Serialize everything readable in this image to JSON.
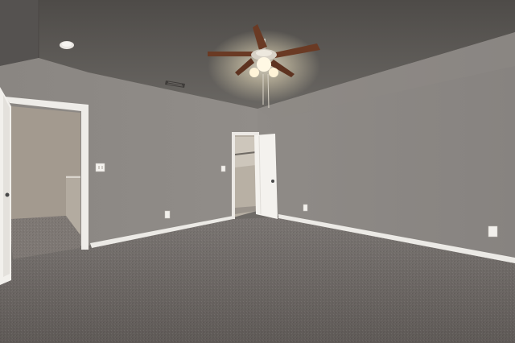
{
  "scene": {
    "subject": "empty-bedroom-interior",
    "elements": [
      "vaulted-ceiling",
      "ceiling-fan",
      "smoke-detector",
      "air-vent",
      "walls",
      "carpet-floor",
      "open-doorway",
      "closet-door",
      "light-switch",
      "wall-outlets",
      "baseboards"
    ]
  },
  "colors": {
    "ceiling": "#5f5c58",
    "wall_left": "#8a8682",
    "wall_right": "#8c8884",
    "wall_back": "#8e8a86",
    "carpet": "#6b6663",
    "trim": "#e8e6e2",
    "fan_blade": "#6a3a24",
    "fan_glow": "#fff6dc"
  }
}
